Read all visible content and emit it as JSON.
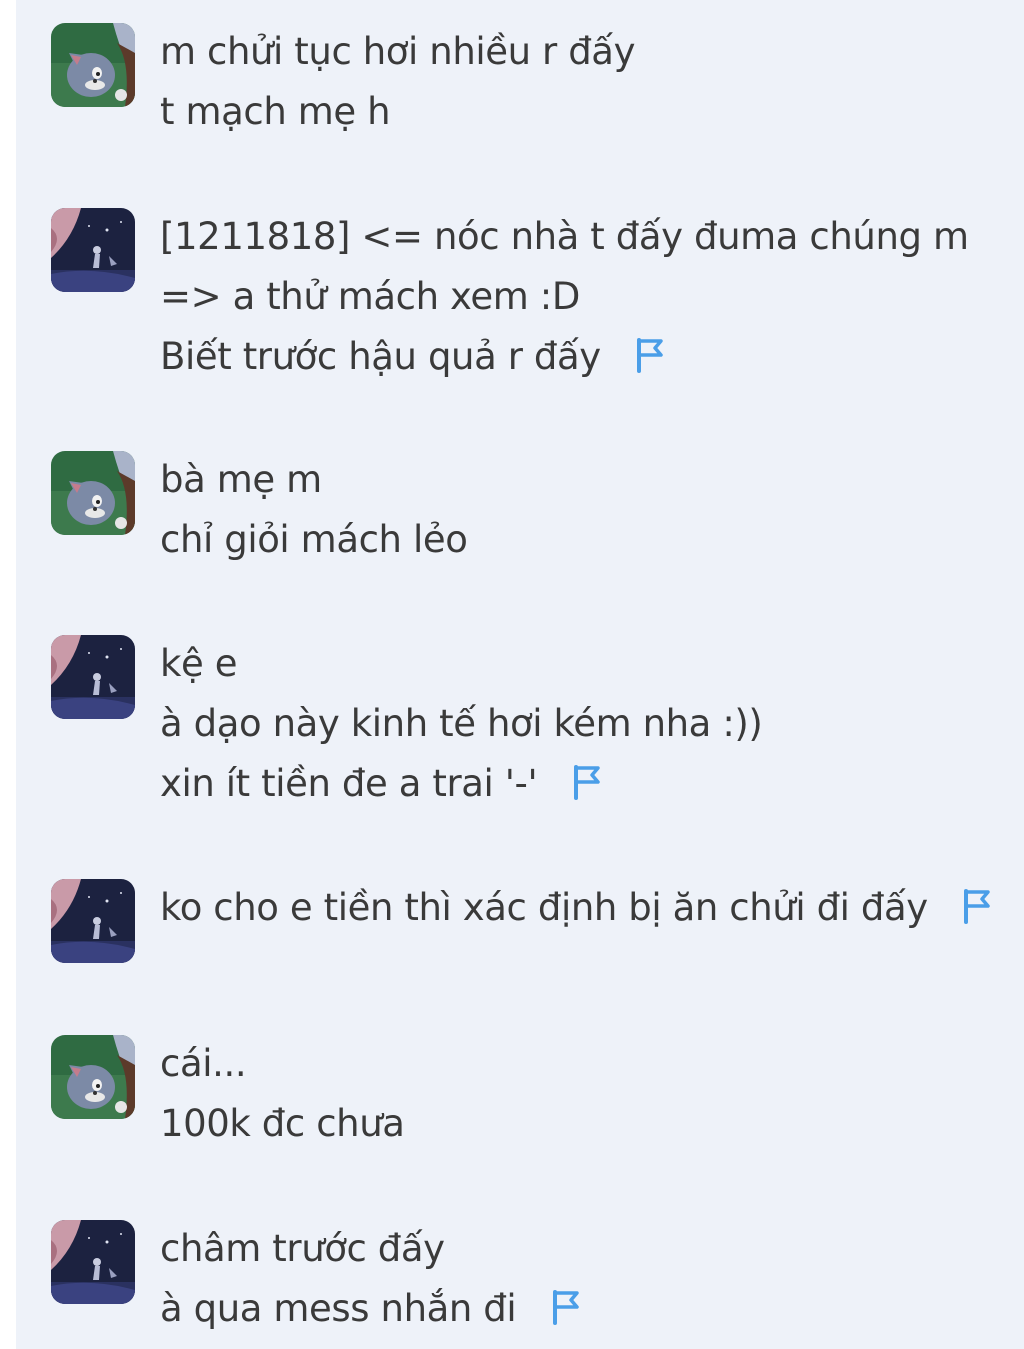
{
  "colors": {
    "panel_background": "#eef2f9",
    "message_text": "#3a3a3a",
    "report_flag": "#4a9ee8"
  },
  "messages": [
    {
      "avatar": "tom-cat-avatar",
      "lines": [
        "m chửi tục hơi nhiều r đấy",
        "t mạch mẹ h"
      ],
      "flag": false
    },
    {
      "avatar": "night-scene-avatar",
      "lines": [
        "[1211818] <= nóc nhà t đấy đuma chúng m",
        "=> a thử mách xem :D",
        "Biết trước hậu quả r đấy"
      ],
      "flag": true
    },
    {
      "avatar": "tom-cat-avatar",
      "lines": [
        "bà mẹ m",
        "chỉ giỏi mách lẻo"
      ],
      "flag": false
    },
    {
      "avatar": "night-scene-avatar",
      "lines": [
        "kệ e",
        "à dạo này kinh tế hơi kém nha :))",
        "xin ít tiền đe a trai '-'"
      ],
      "flag": true
    },
    {
      "avatar": "night-scene-avatar",
      "lines": [
        "ko cho e tiền thì xác định bị ăn chửi đi đấy"
      ],
      "flag": true
    },
    {
      "avatar": "tom-cat-avatar",
      "lines": [
        "cái...",
        "100k đc chưa"
      ],
      "flag": false
    },
    {
      "avatar": "night-scene-avatar",
      "lines": [
        "châm trước đấy",
        "à qua mess nhắn đi"
      ],
      "flag": true
    }
  ]
}
